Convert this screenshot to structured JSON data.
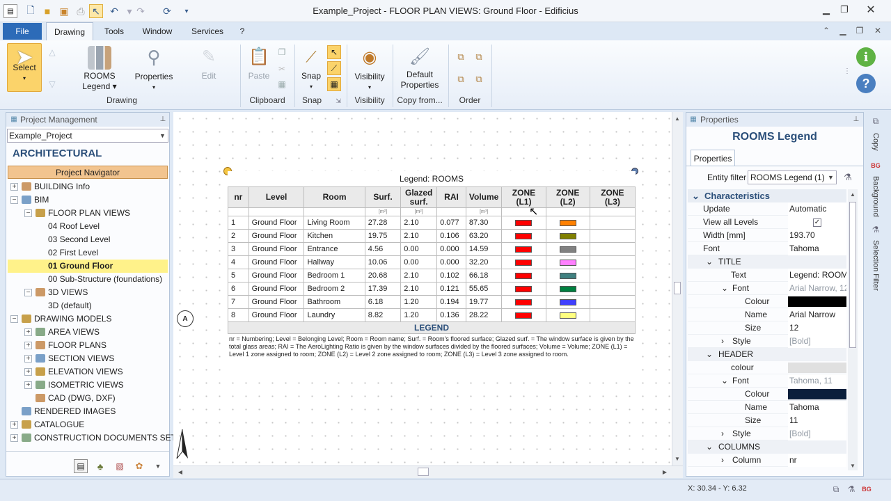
{
  "window": {
    "title": "Example_Project -  FLOOR PLAN VIEWS: Ground Floor - Edificius"
  },
  "menu": {
    "file": "File",
    "drawing": "Drawing",
    "tools": "Tools",
    "window": "Window",
    "services": "Services",
    "help": "?"
  },
  "ribbon": {
    "select": "Select",
    "rooms_legend_1": "ROOMS",
    "rooms_legend_2": "Legend",
    "properties": "Properties",
    "edit": "Edit",
    "paste": "Paste",
    "snap": "Snap",
    "visibility": "Visibility",
    "default_props_1": "Default",
    "default_props_2": "Properties",
    "groups": {
      "drawing": "Drawing",
      "clipboard": "Clipboard",
      "snap": "Snap",
      "visibility": "Visibility",
      "copy_from": "Copy from...",
      "order": "Order"
    }
  },
  "project_panel": {
    "title": "Project Management",
    "project": "Example_Project",
    "category": "ARCHITECTURAL",
    "navigator": "Project Navigator",
    "tree": [
      {
        "label": "BUILDING Info",
        "level": 0,
        "exp": "+"
      },
      {
        "label": "BIM",
        "level": 0,
        "exp": "−"
      },
      {
        "label": "FLOOR PLAN VIEWS",
        "level": 1,
        "exp": "−"
      },
      {
        "label": "04 Roof Level",
        "level": 2,
        "exp": ""
      },
      {
        "label": "03 Second Level",
        "level": 2,
        "exp": ""
      },
      {
        "label": "02 First Level",
        "level": 2,
        "exp": ""
      },
      {
        "label": "01 Ground Floor",
        "level": 2,
        "exp": "",
        "selected": true
      },
      {
        "label": "00 Sub-Structure (foundations)",
        "level": 2,
        "exp": ""
      },
      {
        "label": "3D VIEWS",
        "level": 1,
        "exp": "−"
      },
      {
        "label": "3D (default)",
        "level": 2,
        "exp": ""
      },
      {
        "label": "DRAWING MODELS",
        "level": 0,
        "exp": "−"
      },
      {
        "label": "AREA VIEWS",
        "level": 1,
        "exp": "+"
      },
      {
        "label": "FLOOR PLANS",
        "level": 1,
        "exp": "+"
      },
      {
        "label": "SECTION VIEWS",
        "level": 1,
        "exp": "+"
      },
      {
        "label": "ELEVATION VIEWS",
        "level": 1,
        "exp": "+"
      },
      {
        "label": "ISOMETRIC VIEWS",
        "level": 1,
        "exp": "+"
      },
      {
        "label": "CAD (DWG, DXF)",
        "level": 1,
        "exp": ""
      },
      {
        "label": "RENDERED IMAGES",
        "level": 0,
        "exp": ""
      },
      {
        "label": "CATALOGUE",
        "level": 0,
        "exp": "+"
      },
      {
        "label": "CONSTRUCTION DOCUMENTS SET",
        "level": 0,
        "exp": "+"
      }
    ]
  },
  "legend": {
    "title": "Legend: ROOMS",
    "headers": [
      "nr",
      "Level",
      "Room",
      "Surf.",
      "Glazed surf.",
      "RAI",
      "Volume",
      "ZONE (L1)",
      "ZONE (L2)",
      "ZONE (L3)"
    ],
    "units": [
      "",
      "",
      "",
      "[m²]",
      "[m²]",
      "",
      "[m³]",
      "",
      "",
      ""
    ],
    "rows": [
      {
        "nr": "1",
        "level": "Ground Floor",
        "room": "Living Room",
        "surf": "27.28",
        "glazed": "2.10",
        "rai": "0.077",
        "volume": "87.30",
        "z1": "#ff0000",
        "z2": "#ff8000"
      },
      {
        "nr": "2",
        "level": "Ground Floor",
        "room": "Kitchen",
        "surf": "19.75",
        "glazed": "2.10",
        "rai": "0.106",
        "volume": "63.20",
        "z1": "#ff0000",
        "z2": "#808000"
      },
      {
        "nr": "3",
        "level": "Ground Floor",
        "room": "Entrance",
        "surf": "4.56",
        "glazed": "0.00",
        "rai": "0.000",
        "volume": "14.59",
        "z1": "#ff0000",
        "z2": "#808080"
      },
      {
        "nr": "4",
        "level": "Ground Floor",
        "room": "Hallway",
        "surf": "10.06",
        "glazed": "0.00",
        "rai": "0.000",
        "volume": "32.20",
        "z1": "#ff0000",
        "z2": "#ff80ff"
      },
      {
        "nr": "5",
        "level": "Ground Floor",
        "room": "Bedroom 1",
        "surf": "20.68",
        "glazed": "2.10",
        "rai": "0.102",
        "volume": "66.18",
        "z1": "#ff0000",
        "z2": "#408080"
      },
      {
        "nr": "6",
        "level": "Ground Floor",
        "room": "Bedroom 2",
        "surf": "17.39",
        "glazed": "2.10",
        "rai": "0.121",
        "volume": "55.65",
        "z1": "#ff0000",
        "z2": "#008040"
      },
      {
        "nr": "7",
        "level": "Ground Floor",
        "room": "Bathroom",
        "surf": "6.18",
        "glazed": "1.20",
        "rai": "0.194",
        "volume": "19.77",
        "z1": "#ff0000",
        "z2": "#4040ff"
      },
      {
        "nr": "8",
        "level": "Ground Floor",
        "room": "Laundry",
        "surf": "8.82",
        "glazed": "1.20",
        "rai": "0.136",
        "volume": "28.22",
        "z1": "#ff0000",
        "z2": "#ffff80"
      }
    ],
    "legend_header": "LEGEND",
    "legend_text": "nr = Numbering; Level = Belonging Level; Room = Room name; Surf. = Room's floored surface; Glazed surf. = The window surface is given by the total glass areas; RAI = The AeroLighting Ratio is given by the window surfaces divided by the floored surfaces; Volume = Volume; ZONE (L1) = Level 1 zone assigned to room; ZONE (L2) = Level 2 zone assigned to room; ZONE (L3) = Level 3 zone assigned to room."
  },
  "properties": {
    "panel_title": "Properties",
    "object": "ROOMS Legend",
    "tab": "Properties",
    "entity_filter_label": "Entity filter",
    "entity_filter_value": "ROOMS Legend (1)",
    "rows": [
      {
        "kind": "section",
        "indent": 0,
        "name": "Characteristics",
        "exp": "⌄"
      },
      {
        "kind": "prop",
        "indent": 1,
        "name": "Update",
        "value": "Automatic"
      },
      {
        "kind": "check",
        "indent": 1,
        "name": "View all Levels",
        "value": "✓"
      },
      {
        "kind": "prop",
        "indent": 1,
        "name": "Width  [mm]",
        "value": "193.70"
      },
      {
        "kind": "prop",
        "indent": 1,
        "name": "Font",
        "value": "Tahoma"
      },
      {
        "kind": "sub",
        "indent": 1,
        "name": "TITLE",
        "exp": "⌄"
      },
      {
        "kind": "prop",
        "indent": 2,
        "name": "Text",
        "value": "Legend: ROOMS"
      },
      {
        "kind": "propexp",
        "indent": 2,
        "name": "Font",
        "value": "Arial Narrow, 12",
        "gray": true,
        "exp": "⌄"
      },
      {
        "kind": "color",
        "indent": 3,
        "name": "Colour",
        "value": "#000000"
      },
      {
        "kind": "prop",
        "indent": 3,
        "name": "Name",
        "value": "Arial Narrow"
      },
      {
        "kind": "prop",
        "indent": 3,
        "name": "Size",
        "value": "12"
      },
      {
        "kind": "propexp",
        "indent": 2,
        "name": "Style",
        "value": "[Bold]",
        "gray": true,
        "exp": "›"
      },
      {
        "kind": "sub",
        "indent": 1,
        "name": "HEADER",
        "exp": "⌄"
      },
      {
        "kind": "color",
        "indent": 2,
        "name": "colour",
        "value": "#e0e0e0"
      },
      {
        "kind": "propexp",
        "indent": 2,
        "name": "Font",
        "value": "Tahoma, 11",
        "gray": true,
        "exp": "⌄"
      },
      {
        "kind": "color",
        "indent": 3,
        "name": "Colour",
        "value": "#0a1f3c"
      },
      {
        "kind": "prop",
        "indent": 3,
        "name": "Name",
        "value": "Tahoma"
      },
      {
        "kind": "prop",
        "indent": 3,
        "name": "Size",
        "value": "11"
      },
      {
        "kind": "propexp",
        "indent": 2,
        "name": "Style",
        "value": "[Bold]",
        "gray": true,
        "exp": "›"
      },
      {
        "kind": "sub",
        "indent": 1,
        "name": "COLUMNS",
        "exp": "⌄"
      },
      {
        "kind": "propexp",
        "indent": 2,
        "name": "Column",
        "value": "nr",
        "exp": "›"
      }
    ]
  },
  "side_tabs": [
    "Copy",
    "Background",
    "Selection Filter"
  ],
  "status": {
    "coords": "X: 30.34 - Y: 6.32"
  }
}
